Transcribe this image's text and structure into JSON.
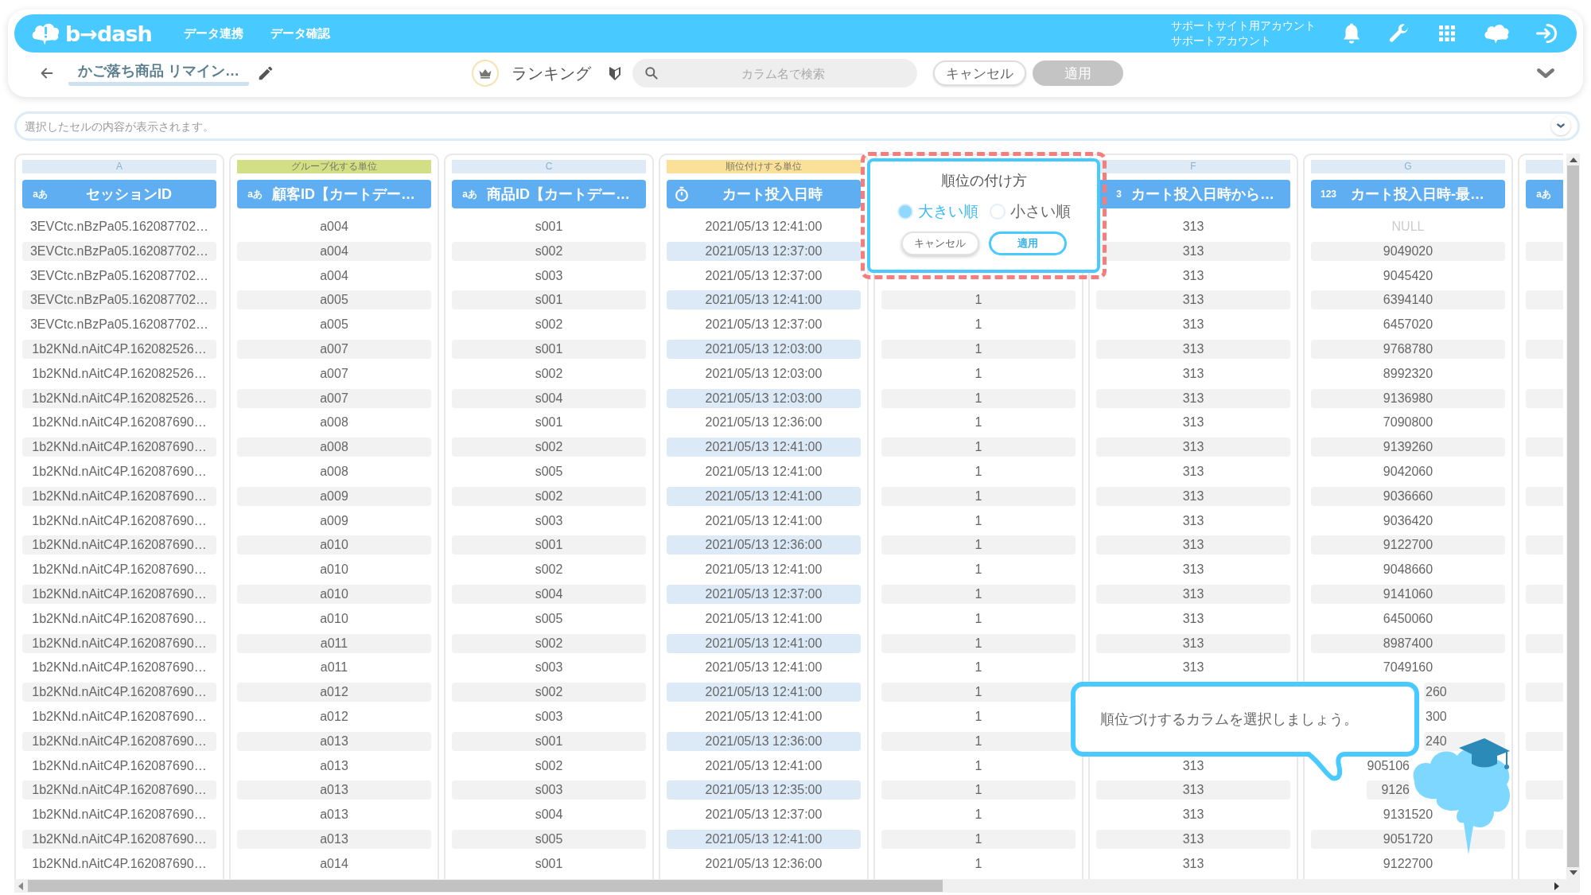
{
  "header": {
    "logo": "b→dash",
    "nav": [
      {
        "label": "データ連携"
      },
      {
        "label": "データ確認"
      }
    ],
    "account": [
      "サポートサイト用アカウント",
      "サポートアカウント"
    ]
  },
  "toolbar": {
    "title": "かご落ち商品 リマイン…",
    "mode_label": "ランキング",
    "search": {
      "placeholder": "カラム名で検索"
    },
    "buttons": [
      {
        "label": "キャンセル",
        "disabled": false
      },
      {
        "label": "適用",
        "disabled": true
      }
    ]
  },
  "cell_content": {
    "placeholder": "選択したセルの内容が表示されます。"
  },
  "columns": [
    {
      "letter": "A",
      "title": "セッションID",
      "kind": "labelled",
      "type_label": "aあ",
      "highlighted": false
    },
    {
      "tag": "グループ化する単位",
      "color": "#d2df84",
      "title": "顧客ID【カートデー…",
      "kind": "labelled",
      "type_label": "aあ",
      "highlighted": false
    },
    {
      "letter": "C",
      "title": "商品ID【カートデー…",
      "kind": "labelled",
      "type_label": "aあ",
      "highlighted": false
    },
    {
      "tag": "順位付けする単位",
      "color": "#fbe09a",
      "title": "カート投入日時",
      "kind": "datetime",
      "highlighted": true
    },
    {
      "highlighted": false
    },
    {
      "letter": "F",
      "title": "カート投入日時から…",
      "kind": "labelled",
      "type_label": "3",
      "highlighted": false
    },
    {
      "letter": "G",
      "title": "カート投入日時-最…",
      "kind": "labelled",
      "type_label": "123",
      "highlighted": false
    },
    {
      "kind": "labelled",
      "type_label": "aあ",
      "highlighted": false
    }
  ],
  "rows": [
    [
      "3EVCtc.nBzPa05.162087702…",
      "a004",
      "s001",
      "2021/05/13 12:41:00",
      null,
      "313",
      {
        "text": "NULL",
        "muted": true
      },
      null
    ],
    [
      "3EVCtc.nBzPa05.162087702…",
      "a004",
      "s002",
      "2021/05/13 12:37:00",
      null,
      "313",
      "9049020",
      null
    ],
    [
      "3EVCtc.nBzPa05.162087702…",
      "a004",
      "s003",
      "2021/05/13 12:37:00",
      null,
      "313",
      "9045420",
      null
    ],
    [
      "3EVCtc.nBzPa05.162087702…",
      "a005",
      "s001",
      "2021/05/13 12:41:00",
      "1",
      "313",
      "6394140",
      null
    ],
    [
      "3EVCtc.nBzPa05.162087702…",
      "a005",
      "s002",
      "2021/05/13 12:37:00",
      "1",
      "313",
      "6457020",
      null
    ],
    [
      "1b2KNd.nAitC4P.162082526…",
      "a007",
      "s001",
      "2021/05/13 12:03:00",
      "1",
      "313",
      "9768780",
      null
    ],
    [
      "1b2KNd.nAitC4P.162082526…",
      "a007",
      "s002",
      "2021/05/13 12:03:00",
      "1",
      "313",
      "8992320",
      null
    ],
    [
      "1b2KNd.nAitC4P.162082526…",
      "a007",
      "s004",
      "2021/05/13 12:03:00",
      "1",
      "313",
      "9136980",
      null
    ],
    [
      "1b2KNd.nAitC4P.162087690…",
      "a008",
      "s001",
      "2021/05/13 12:36:00",
      "1",
      "313",
      "7090800",
      null
    ],
    [
      "1b2KNd.nAitC4P.162087690…",
      "a008",
      "s002",
      "2021/05/13 12:41:00",
      "1",
      "313",
      "9139260",
      null
    ],
    [
      "1b2KNd.nAitC4P.162087690…",
      "a008",
      "s005",
      "2021/05/13 12:41:00",
      "1",
      "313",
      "9042060",
      null
    ],
    [
      "1b2KNd.nAitC4P.162087690…",
      "a009",
      "s002",
      "2021/05/13 12:41:00",
      "1",
      "313",
      "9036660",
      null
    ],
    [
      "1b2KNd.nAitC4P.162087690…",
      "a009",
      "s003",
      "2021/05/13 12:41:00",
      "1",
      "313",
      "9036420",
      null
    ],
    [
      "1b2KNd.nAitC4P.162087690…",
      "a010",
      "s001",
      "2021/05/13 12:36:00",
      "1",
      "313",
      "9122700",
      null
    ],
    [
      "1b2KNd.nAitC4P.162087690…",
      "a010",
      "s002",
      "2021/05/13 12:41:00",
      "1",
      "313",
      "9048660",
      null
    ],
    [
      "1b2KNd.nAitC4P.162087690…",
      "a010",
      "s004",
      "2021/05/13 12:37:00",
      "1",
      "313",
      "9141060",
      null
    ],
    [
      "1b2KNd.nAitC4P.162087690…",
      "a010",
      "s005",
      "2021/05/13 12:41:00",
      "1",
      "313",
      "6450060",
      null
    ],
    [
      "1b2KNd.nAitC4P.162087690…",
      "a011",
      "s002",
      "2021/05/13 12:41:00",
      "1",
      "313",
      "8987400",
      null
    ],
    [
      "1b2KNd.nAitC4P.162087690…",
      "a011",
      "s003",
      "2021/05/13 12:41:00",
      "1",
      "313",
      "7049160",
      null
    ],
    [
      "1b2KNd.nAitC4P.162087690…",
      "a012",
      "s002",
      "2021/05/13 12:41:00",
      "1",
      null,
      {
        "text": "260",
        "kind": "tail"
      },
      null
    ],
    [
      "1b2KNd.nAitC4P.162087690…",
      "a012",
      "s003",
      "2021/05/13 12:41:00",
      "1",
      null,
      {
        "text": "300",
        "kind": "tail"
      },
      null
    ],
    [
      "1b2KNd.nAitC4P.162087690…",
      "a013",
      "s001",
      "2021/05/13 12:36:00",
      "1",
      null,
      {
        "text": "240",
        "kind": "tail"
      },
      null
    ],
    [
      "1b2KNd.nAitC4P.162087690…",
      "a013",
      "s002",
      "2021/05/13 12:41:00",
      "1",
      "313",
      {
        "text": "905106",
        "kind": "head"
      },
      null
    ],
    [
      "1b2KNd.nAitC4P.162087690…",
      "a013",
      "s003",
      "2021/05/13 12:35:00",
      "1",
      "313",
      {
        "text": "9126",
        "kind": "head"
      },
      null
    ],
    [
      "1b2KNd.nAitC4P.162087690…",
      "a013",
      "s004",
      "2021/05/13 12:37:00",
      "1",
      "313",
      "9131520",
      null
    ],
    [
      "1b2KNd.nAitC4P.162087690…",
      "a013",
      "s005",
      "2021/05/13 12:41:00",
      "1",
      "313",
      "9051720",
      null
    ],
    [
      "1b2KNd.nAitC4P.162087690…",
      "a014",
      "s001",
      "2021/05/13 12:36:00",
      "1",
      "313",
      "9122700",
      null
    ]
  ],
  "popup": {
    "title": "順位の付け方",
    "options": [
      {
        "label": "大きい順",
        "selected": true
      },
      {
        "label": "小さい順",
        "selected": false
      }
    ],
    "buttons": [
      {
        "label": "キャンセル",
        "primary": false
      },
      {
        "label": "適用",
        "primary": true
      }
    ]
  },
  "hint": {
    "text": "順位づけするカラムを選択しましょう。"
  }
}
